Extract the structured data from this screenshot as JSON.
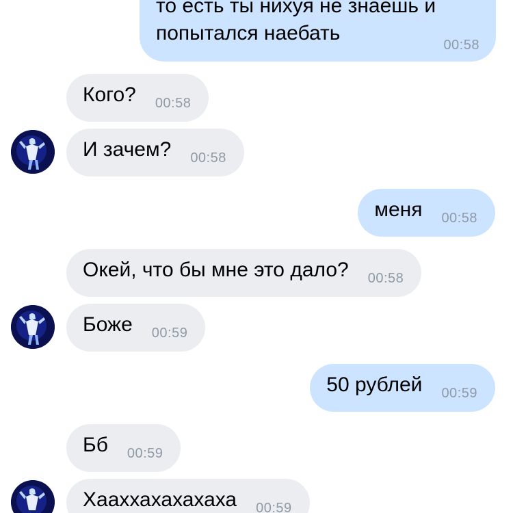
{
  "messages": [
    {
      "id": "m1",
      "side": "out",
      "lines": [
        "то есть ты нихуя не знаешь и",
        "попытался наебать"
      ],
      "time": "00:58"
    },
    {
      "id": "m2",
      "side": "in",
      "text": "Кого?",
      "time": "00:58"
    },
    {
      "id": "m3",
      "side": "in",
      "text": "И зачем?",
      "time": "00:58",
      "avatar": "user-avatar"
    },
    {
      "id": "m4",
      "side": "out",
      "text": "меня",
      "time": "00:58"
    },
    {
      "id": "m5",
      "side": "in",
      "text": "Окей, что бы мне это дало?",
      "time": "00:58"
    },
    {
      "id": "m6",
      "side": "in",
      "text": "Боже",
      "time": "00:59",
      "avatar": "user-avatar"
    },
    {
      "id": "m7",
      "side": "out",
      "text": "50 рублей",
      "time": "00:59"
    },
    {
      "id": "m8",
      "side": "in",
      "text": "Бб",
      "time": "00:59"
    },
    {
      "id": "m9",
      "side": "in",
      "text": "Хааххахахахаха",
      "time": "00:59",
      "avatar": "user-avatar"
    }
  ],
  "colors": {
    "incoming_bubble": "#ecedf1",
    "outgoing_bubble": "#cce4ff",
    "timestamp": "#8e9aa6",
    "text": "#000000"
  }
}
